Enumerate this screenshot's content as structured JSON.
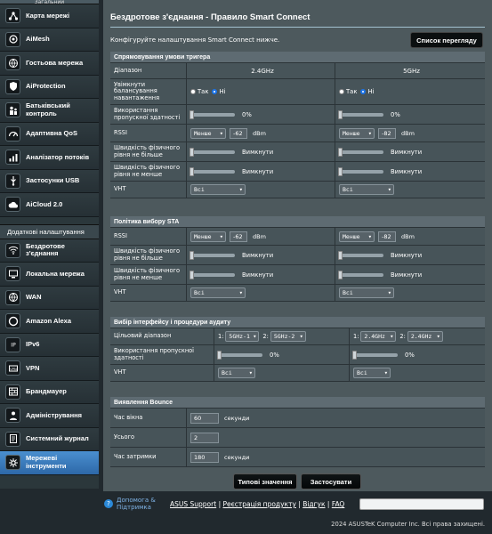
{
  "sidebar": {
    "top_label": "Загальний",
    "items": [
      {
        "label": "Карта мережі",
        "icon": "network-map-icon"
      },
      {
        "label": "AiMesh",
        "icon": "aimesh-icon"
      },
      {
        "label": "Гостьова мережа",
        "icon": "guest-network-icon"
      },
      {
        "label": "AiProtection",
        "icon": "shield-icon"
      },
      {
        "label": "Батьківський контроль",
        "icon": "parental-control-icon"
      },
      {
        "label": "Адаптивна QoS",
        "icon": "qos-icon"
      },
      {
        "label": "Аналізатор потоків",
        "icon": "traffic-analyzer-icon"
      },
      {
        "label": "Застосунки USB",
        "icon": "usb-icon"
      },
      {
        "label": "AiCloud 2.0",
        "icon": "cloud-icon"
      }
    ],
    "advanced_title": "Додаткові налаштування",
    "advanced_items": [
      {
        "label": "Бездротове з'єднання",
        "icon": "wireless-icon"
      },
      {
        "label": "Локальна мережа",
        "icon": "lan-icon"
      },
      {
        "label": "WAN",
        "icon": "globe-icon"
      },
      {
        "label": "Amazon Alexa",
        "icon": "alexa-icon"
      },
      {
        "label": "IPv6",
        "icon": "ipv6-icon"
      },
      {
        "label": "VPN",
        "icon": "vpn-icon"
      },
      {
        "label": "Брандмауер",
        "icon": "firewall-icon"
      },
      {
        "label": "Адміністрування",
        "icon": "admin-icon"
      },
      {
        "label": "Системний журнал",
        "icon": "syslog-icon"
      },
      {
        "label": "Мережеві інструменти",
        "icon": "tools-icon"
      }
    ]
  },
  "page": {
    "title": "Бездротове з'єднання - Правило Smart Connect",
    "description": "Конфігуруйте налаштування Smart Connect нижче.",
    "list_button": "Список перегляду"
  },
  "trigger": {
    "header": "Спрямовування умови тригера",
    "band_label": "Діапазон",
    "band_24": "2.4GHz",
    "band_5": "5GHz",
    "balance_label": "Увімкнути балансування навантаження",
    "yes": "Так",
    "no": "Ні",
    "util_label": "Використання пропускної здатності",
    "util_24": "0%",
    "util_5": "0%",
    "rssi_label": "RSSI",
    "rssi_op": "Менше",
    "rssi_24": "-62",
    "rssi_5": "-82",
    "dbm": "dBm",
    "phy_max_label": "Швидкість фізичного рівня не більше",
    "phy_min_label": "Швидкість фізичного рівня не менше",
    "off": "Вимкнути",
    "vht_label": "VHT",
    "vht_value": "Всі"
  },
  "sta": {
    "header": "Політика вибору STA",
    "rssi_label": "RSSI",
    "rssi_op": "Менше",
    "rssi_24": "-62",
    "rssi_5": "-82",
    "dbm": "dBm",
    "phy_max_label": "Швидкість фізичного рівня не більше",
    "phy_min_label": "Швидкість фізичного рівня не менше",
    "off": "Вимкнути",
    "vht_label": "VHT",
    "vht_value": "Всі"
  },
  "iface": {
    "header": "Вибір інтерфейсу і процедури аудиту",
    "target_label": "Цільовий діапазон",
    "n1": "1:",
    "n2": "2:",
    "t24_1": "5GHz-1",
    "t24_2": "5GHz-2",
    "t5_1": "2.4GHz",
    "t5_2": "2.4GHz",
    "util_label": "Використання пропускної здатності",
    "util_24": "0%",
    "util_5": "0%",
    "vht_label": "VHT",
    "vht_value": "Всі"
  },
  "bounce": {
    "header": "Виявлення Bounce",
    "window_label": "Час вікна",
    "window_value": "60",
    "seconds": "секунди",
    "total_label": "Усього",
    "total_value": "2",
    "delay_label": "Час затримки",
    "delay_value": "180"
  },
  "actions": {
    "defaults": "Типові значення",
    "apply": "Застосувати"
  },
  "footer": {
    "help": "Допомога &",
    "help2": "Підтримка",
    "asus_support": "ASUS Support",
    "sep": " | ",
    "register": "Реєстрація продукту",
    "feedback": "Відгук",
    "faq": "FAQ",
    "copyright": "2024 ASUSTeK Computer Inc. Всі права захищені."
  }
}
